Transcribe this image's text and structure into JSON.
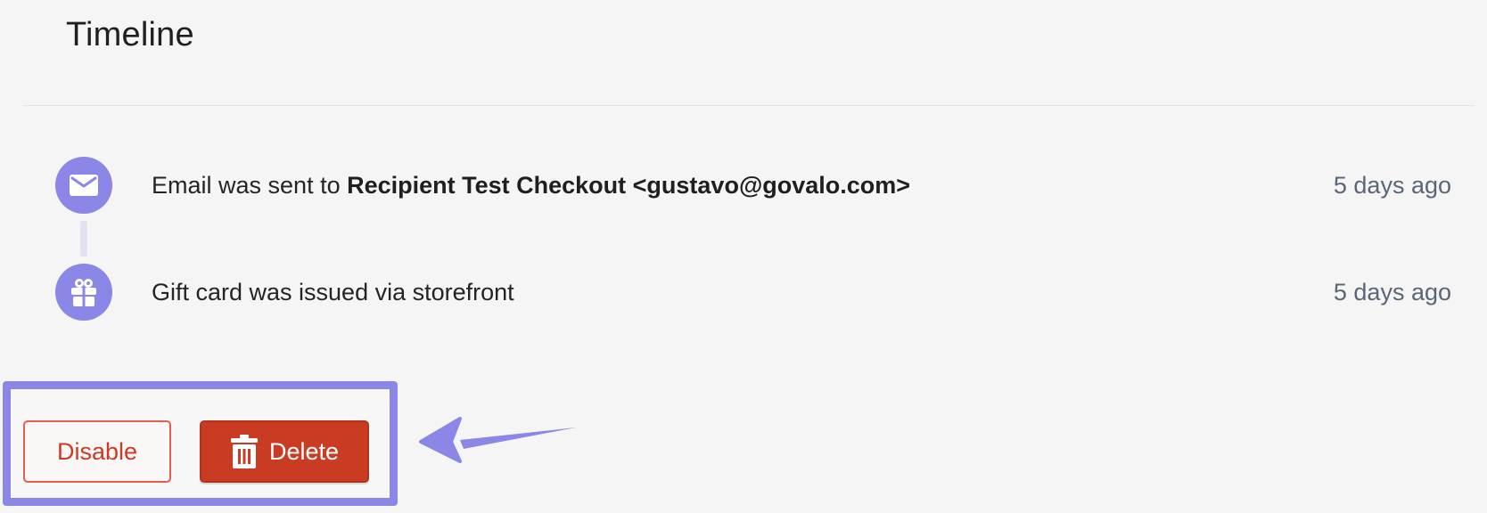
{
  "timeline": {
    "title": "Timeline",
    "events": [
      {
        "icon": "envelope-icon",
        "message_prefix": "Email was sent to ",
        "message_bold": "Recipient Test Checkout <gustavo@govalo.com>",
        "time": "5 days ago"
      },
      {
        "icon": "gift-icon",
        "message_prefix": "Gift card was issued via storefront",
        "message_bold": "",
        "time": "5 days ago"
      }
    ]
  },
  "actions": {
    "disable_label": "Disable",
    "delete_label": "Delete",
    "delete_icon": "trash-icon"
  },
  "colors": {
    "accent": "#8b87e6",
    "danger": "#c93c23",
    "danger_border": "#e35e4c",
    "background": "#f5f5f5",
    "timestamp": "#5a6578"
  }
}
